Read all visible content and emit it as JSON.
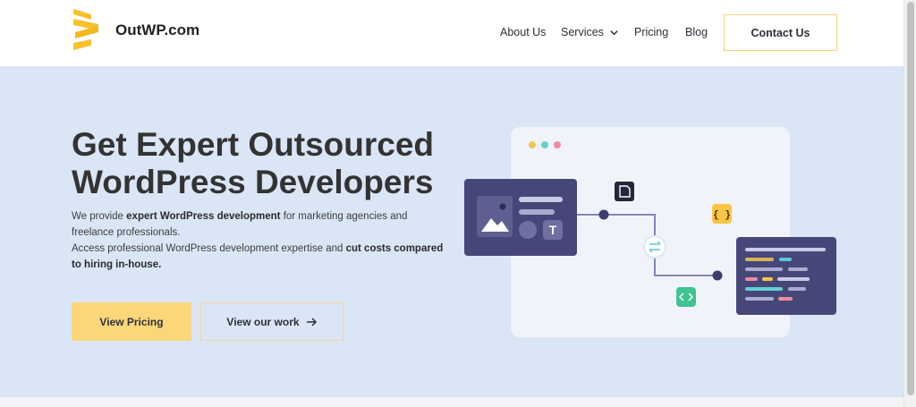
{
  "brand": {
    "name": "OutWP.com",
    "logo_icon": "stacked-bars-logo",
    "logo_color": "#f8c12c"
  },
  "nav": {
    "about": "About Us",
    "services": "Services",
    "pricing": "Pricing",
    "blog": "Blog",
    "contact": "Contact Us"
  },
  "hero": {
    "title": "Get Expert Outsourced WordPress Developers",
    "desc": {
      "p1_a": "We provide ",
      "p1_b": "expert WordPress development",
      "p1_c": " for marketing agencies and freelance professionals.",
      "p2_a": "Access professional WordPress development expertise and ",
      "p2_b": "cut costs compared to hiring in-house."
    },
    "primary_button": "View Pricing",
    "secondary_button": "View our work",
    "secondary_icon": "arrow-right-icon"
  },
  "illustration": {
    "icons": [
      "image-icon",
      "text-t-icon",
      "file-icon",
      "braces-icon",
      "swap-icon",
      "code-icon"
    ],
    "brace_badge": "{ }",
    "t_glyph": "T",
    "colors": {
      "background": "#dae5f6",
      "panel": "#f1f3fa",
      "dark_card": "#464779",
      "accent_yellow": "#fbc544",
      "accent_green": "#3fc390"
    }
  }
}
